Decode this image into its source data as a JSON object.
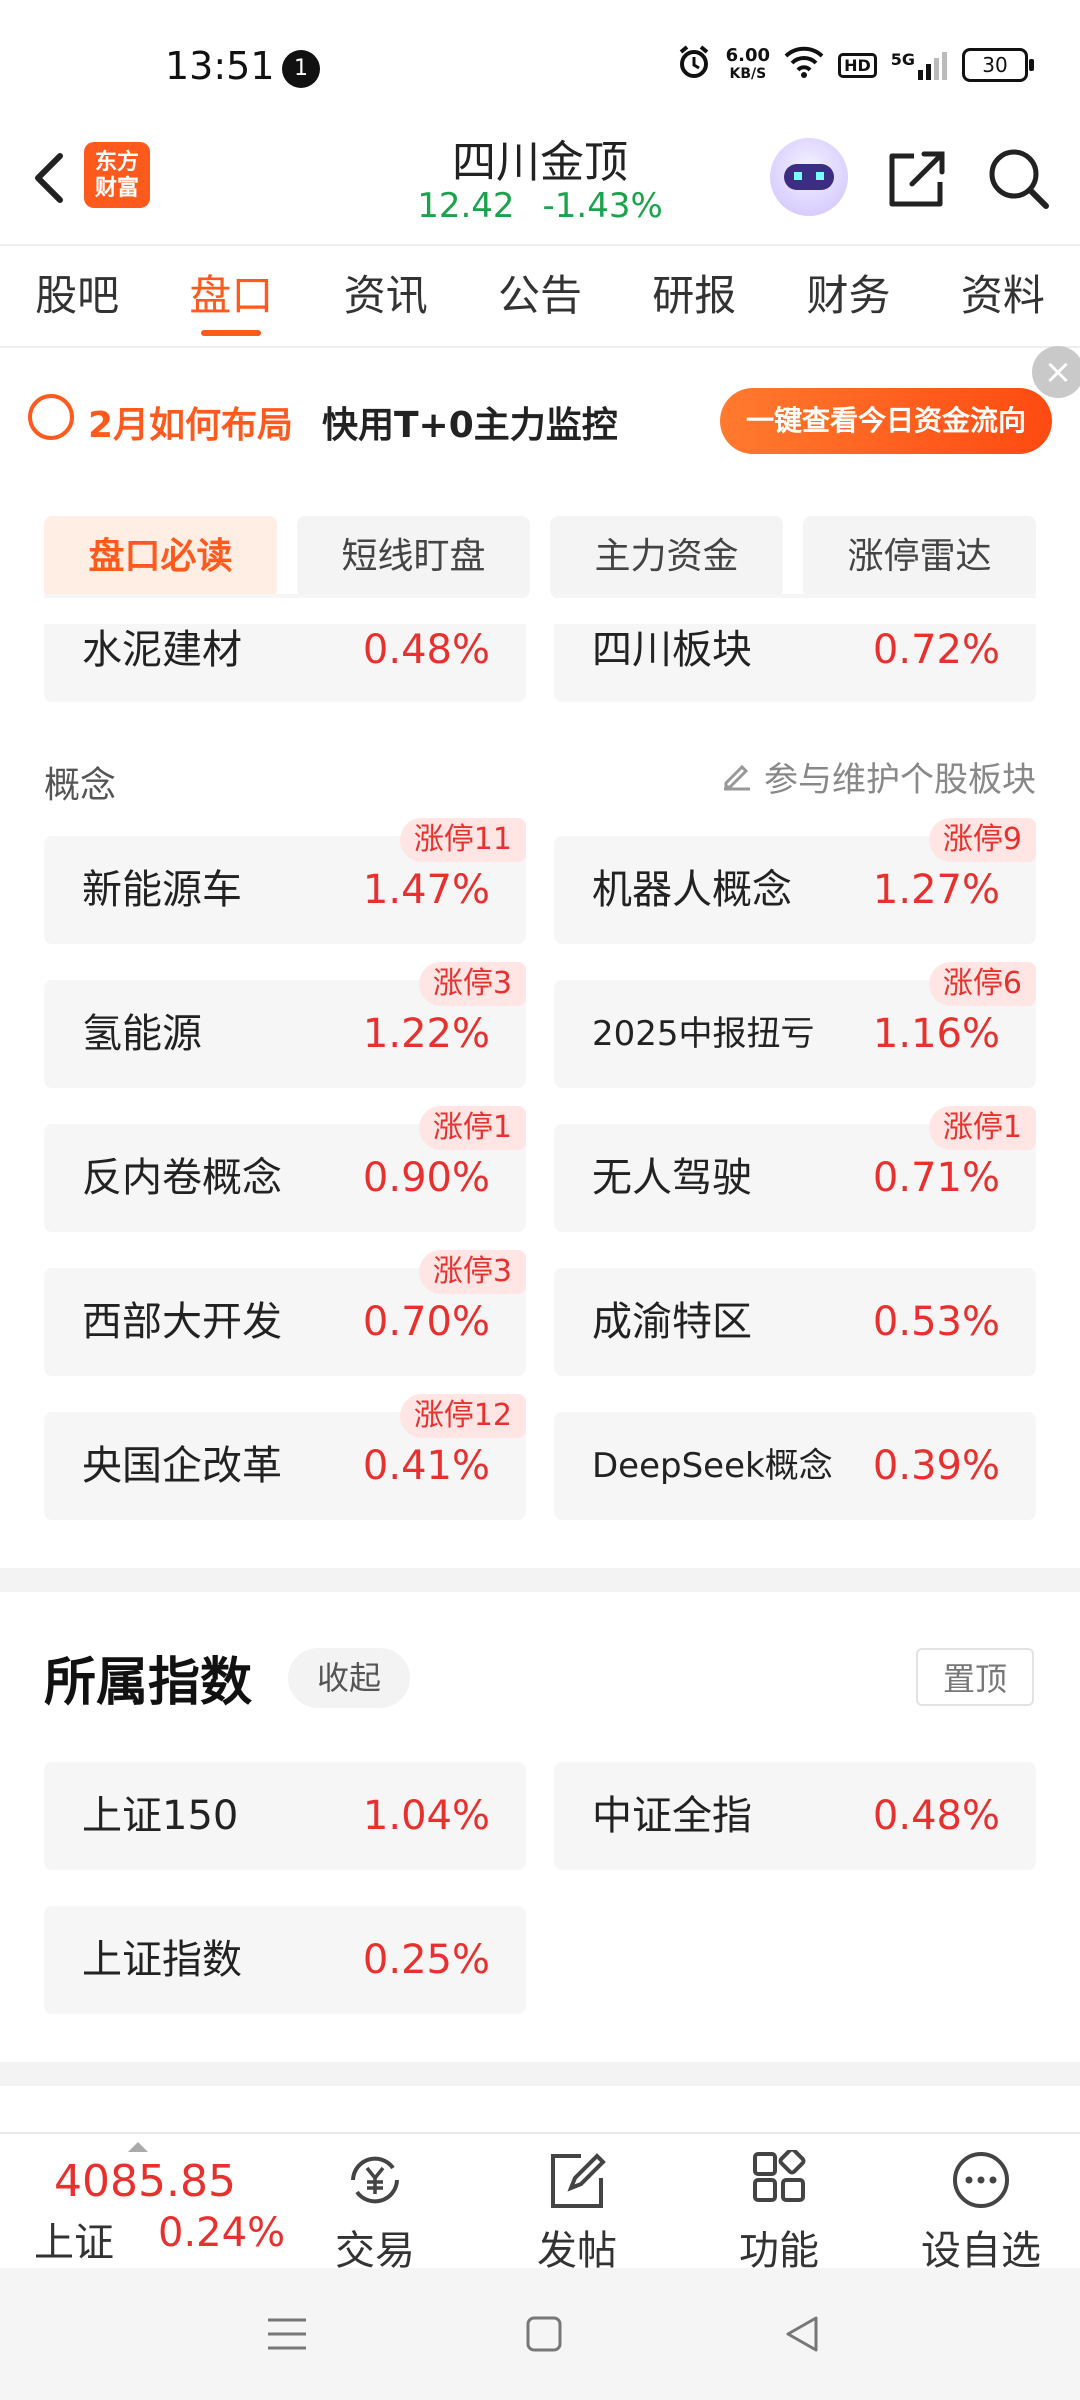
{
  "status_bar": {
    "time": "13:51",
    "notification_count": "1",
    "speed_value": "6.00",
    "speed_unit": "KB/S",
    "hd": "HD",
    "network": "5G",
    "battery": "30"
  },
  "header": {
    "logo_line1": "东方",
    "logo_line2": "财富",
    "title": "四川金顶",
    "price": "12.42",
    "change": "-1.43%"
  },
  "tabs": [
    "股吧",
    "盘口",
    "资讯",
    "公告",
    "研报",
    "财务",
    "资料"
  ],
  "banner": {
    "text1": "2月如何布局",
    "text2": "快用T+0主力监控",
    "button": "一键查看今日资金流向",
    "close": "×"
  },
  "subtabs": [
    "盘口必读",
    "短线盯盘",
    "主力资金",
    "涨停雷达"
  ],
  "industry": [
    {
      "name": "水泥建材",
      "pct": "0.48%"
    },
    {
      "name": "四川板块",
      "pct": "0.72%"
    }
  ],
  "concept": {
    "label": "概念",
    "maintain": "参与维护个股板块",
    "items": [
      {
        "name": "新能源车",
        "pct": "1.47%",
        "badge": "涨停11"
      },
      {
        "name": "机器人概念",
        "pct": "1.27%",
        "badge": "涨停9"
      },
      {
        "name": "氢能源",
        "pct": "1.22%",
        "badge": "涨停3"
      },
      {
        "name": "2025中报扭亏",
        "pct": "1.16%",
        "badge": "涨停6"
      },
      {
        "name": "反内卷概念",
        "pct": "0.90%",
        "badge": "涨停1"
      },
      {
        "name": "无人驾驶",
        "pct": "0.71%",
        "badge": "涨停1"
      },
      {
        "name": "西部大开发",
        "pct": "0.70%",
        "badge": "涨停3"
      },
      {
        "name": "成渝特区",
        "pct": "0.53%",
        "badge": ""
      },
      {
        "name": "央国企改革",
        "pct": "0.41%",
        "badge": "涨停12"
      },
      {
        "name": "DeepSeek概念",
        "pct": "0.39%",
        "badge": ""
      }
    ]
  },
  "indices": {
    "title": "所属指数",
    "collapse": "收起",
    "pin": "置顶",
    "items": [
      {
        "name": "上证150",
        "pct": "1.04%"
      },
      {
        "name": "中证全指",
        "pct": "0.48%"
      },
      {
        "name": "上证指数",
        "pct": "0.25%"
      }
    ]
  },
  "bottom_bar": {
    "index_value": "4085.85",
    "index_name": "上证",
    "index_pct": "0.24%",
    "nav": [
      "交易",
      "发帖",
      "功能",
      "设自选"
    ]
  },
  "colors": {
    "accent": "#ff5a1e",
    "up": "#e8312f",
    "down": "#1aa34a"
  }
}
